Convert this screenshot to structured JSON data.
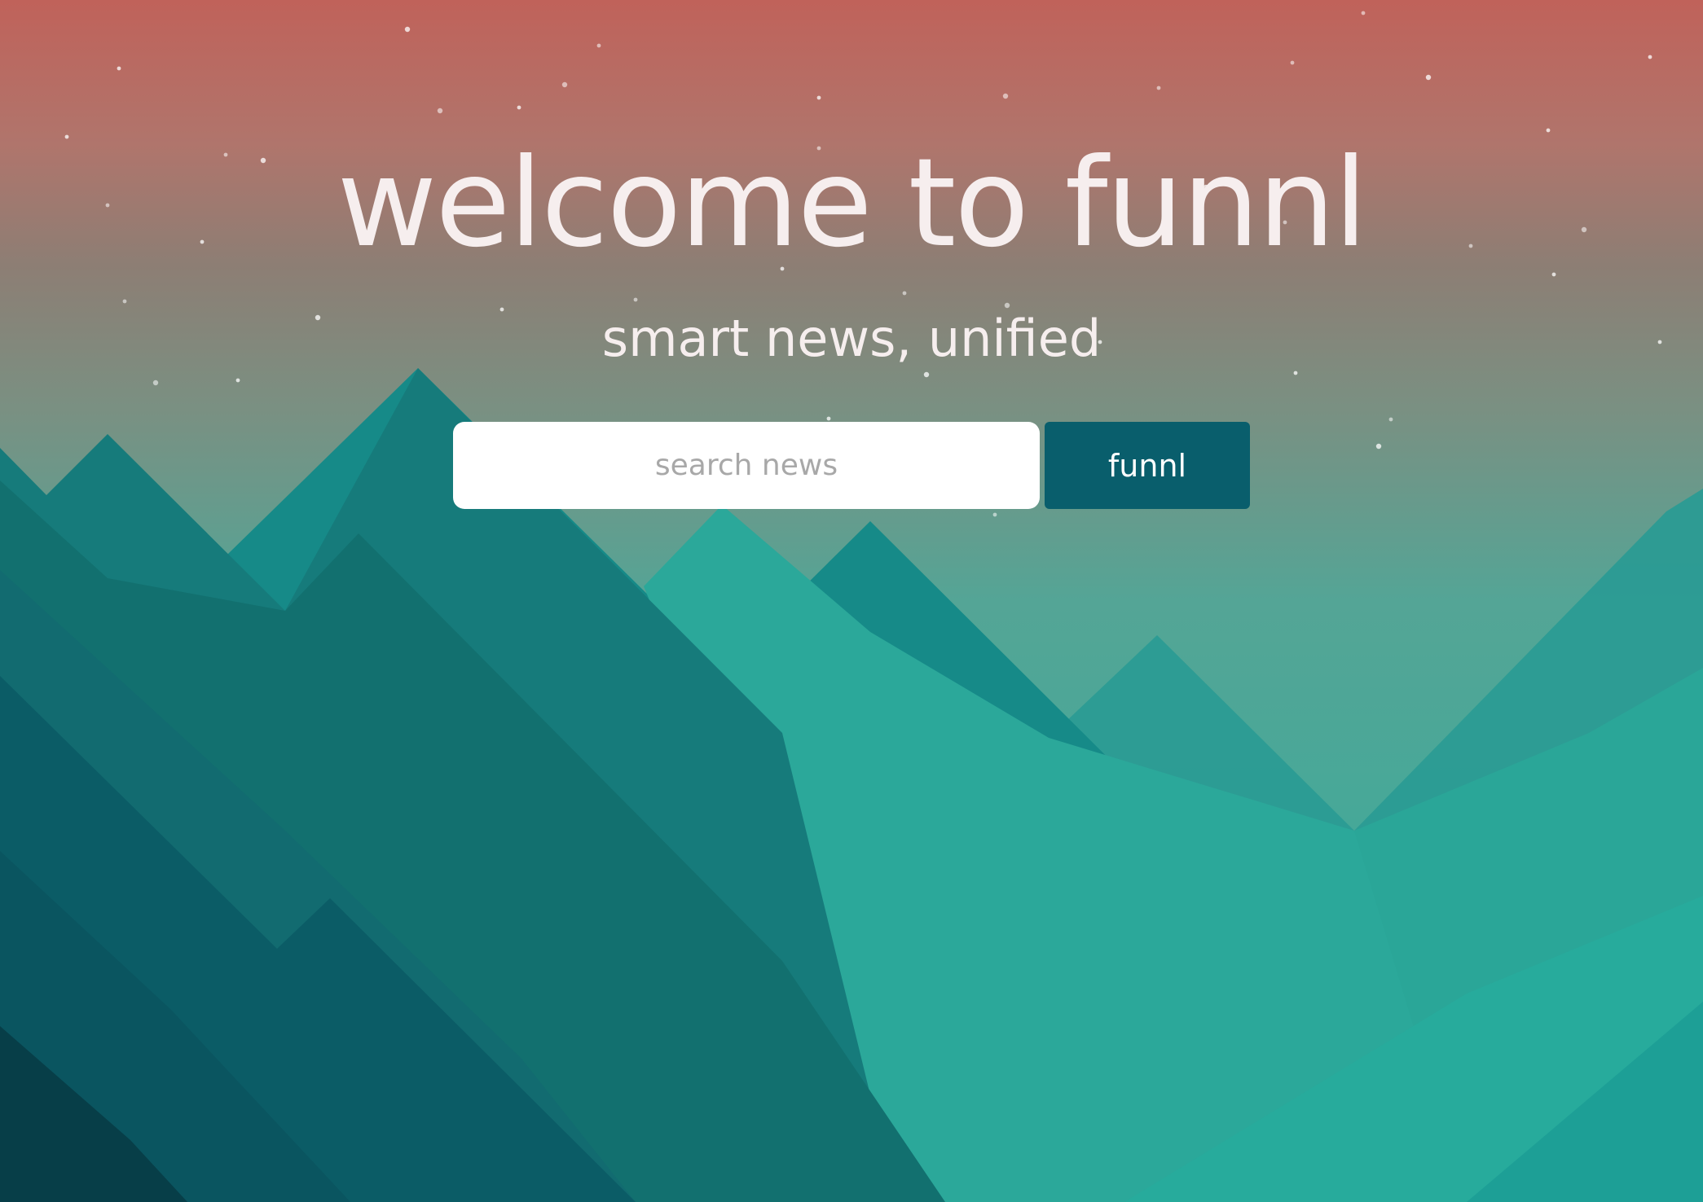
{
  "hero": {
    "title": "welcome to funnl",
    "subtitle": "smart news, unified"
  },
  "search": {
    "placeholder": "search news",
    "value": "",
    "button_label": "funnl"
  },
  "theme": {
    "sky_top": "#b9625c",
    "sky_mid": "#8a8a80",
    "sky_bottom": "#55a89a",
    "text_color": "#f6eeee",
    "button_color": "#095e6c",
    "button_text_color": "#ffffff",
    "input_background": "#ffffff"
  },
  "background": {
    "name": "mountain-landscape",
    "star_count": 45
  }
}
